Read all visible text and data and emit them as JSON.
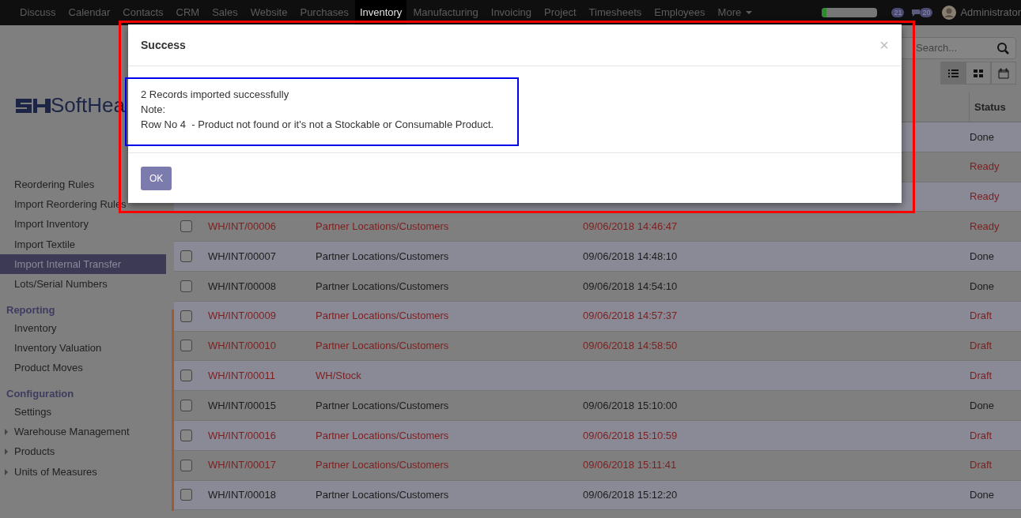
{
  "top_menu": [
    {
      "label": "Discuss",
      "selected": false
    },
    {
      "label": "Calendar",
      "selected": false
    },
    {
      "label": "Contacts",
      "selected": false
    },
    {
      "label": "CRM",
      "selected": false
    },
    {
      "label": "Sales",
      "selected": false
    },
    {
      "label": "Website",
      "selected": false
    },
    {
      "label": "Purchases",
      "selected": false
    },
    {
      "label": "Inventory",
      "selected": true
    },
    {
      "label": "Manufacturing",
      "selected": false
    },
    {
      "label": "Invoicing",
      "selected": false
    },
    {
      "label": "Project",
      "selected": false
    },
    {
      "label": "Timesheets",
      "selected": false
    },
    {
      "label": "Employees",
      "selected": false
    },
    {
      "label": "More",
      "selected": false
    }
  ],
  "systray": {
    "progress": {
      "level": 0.08
    },
    "activity_count": "21",
    "messages_count": "20",
    "user": "Administrator"
  },
  "sidebar": {
    "logo_text": "SoftHea",
    "items": [
      {
        "kind": "item",
        "label": "Reordering Rules",
        "selected": false
      },
      {
        "kind": "item",
        "label": "Import Reordering Rules",
        "selected": false
      },
      {
        "kind": "item",
        "label": "Import Inventory",
        "selected": false
      },
      {
        "kind": "item",
        "label": "Import Textile",
        "selected": false
      },
      {
        "kind": "item",
        "label": "Import Internal Transfer",
        "selected": true
      },
      {
        "kind": "item",
        "label": "Lots/Serial Numbers",
        "selected": false
      },
      {
        "kind": "section",
        "label": "Reporting"
      },
      {
        "kind": "item",
        "label": "Inventory",
        "selected": false
      },
      {
        "kind": "item",
        "label": "Inventory Valuation",
        "selected": false
      },
      {
        "kind": "item",
        "label": "Product Moves",
        "selected": false
      },
      {
        "kind": "section",
        "label": "Configuration"
      },
      {
        "kind": "item",
        "label": "Settings",
        "selected": false
      },
      {
        "kind": "expandable",
        "label": "Warehouse Management"
      },
      {
        "kind": "expandable",
        "label": "Products"
      },
      {
        "kind": "expandable",
        "label": "Units of Measures"
      }
    ]
  },
  "control_panel": {
    "search": {
      "placeholder": "Search..."
    },
    "views": [
      {
        "kind": "list",
        "selected": true
      },
      {
        "kind": "kanban",
        "selected": false
      },
      {
        "kind": "calendar",
        "selected": false
      }
    ]
  },
  "table": {
    "columns": [
      {
        "label": "Status"
      }
    ],
    "rows": [
      {
        "status": "Done",
        "emphasized": false
      },
      {
        "status": "Ready",
        "emphasized": true
      },
      {
        "status": "Ready",
        "emphasized": true
      },
      {
        "reference": "WH/INT/00006",
        "location": "Partner Locations/Customers",
        "date": "09/06/2018 14:46:47",
        "status": "Ready",
        "emphasized": true
      },
      {
        "reference": "WH/INT/00007",
        "location": "Partner Locations/Customers",
        "date": "09/06/2018 14:48:10",
        "status": "Done",
        "emphasized": false
      },
      {
        "reference": "WH/INT/00008",
        "location": "Partner Locations/Customers",
        "date": "09/06/2018 14:54:10",
        "status": "Done",
        "emphasized": false
      },
      {
        "reference": "WH/INT/00009",
        "location": "Partner Locations/Customers",
        "date": "09/06/2018 14:57:37",
        "status": "Draft",
        "emphasized": true
      },
      {
        "reference": "WH/INT/00010",
        "location": "Partner Locations/Customers",
        "date": "09/06/2018 14:58:50",
        "status": "Draft",
        "emphasized": true
      },
      {
        "reference": "WH/INT/00011",
        "location": "WH/Stock",
        "status": "Draft",
        "emphasized": true
      },
      {
        "reference": "WH/INT/00015",
        "location": "Partner Locations/Customers",
        "date": "09/06/2018 15:10:00",
        "status": "Done",
        "emphasized": false
      },
      {
        "reference": "WH/INT/00016",
        "location": "Partner Locations/Customers",
        "date": "09/06/2018 15:10:59",
        "status": "Draft",
        "emphasized": true
      },
      {
        "reference": "WH/INT/00017",
        "location": "Partner Locations/Customers",
        "date": "09/06/2018 15:11:41",
        "status": "Draft",
        "emphasized": true
      },
      {
        "reference": "WH/INT/00018",
        "location": "Partner Locations/Customers",
        "date": "09/06/2018 15:12:20",
        "status": "Done",
        "emphasized": false
      }
    ]
  },
  "dialog": {
    "title": "Success",
    "close": "×",
    "lines": [
      "2 Records imported successfully",
      "Note:",
      "Row No 4  - Product not found or it's not a Stockable or Consumable Product."
    ],
    "button": "OK"
  }
}
